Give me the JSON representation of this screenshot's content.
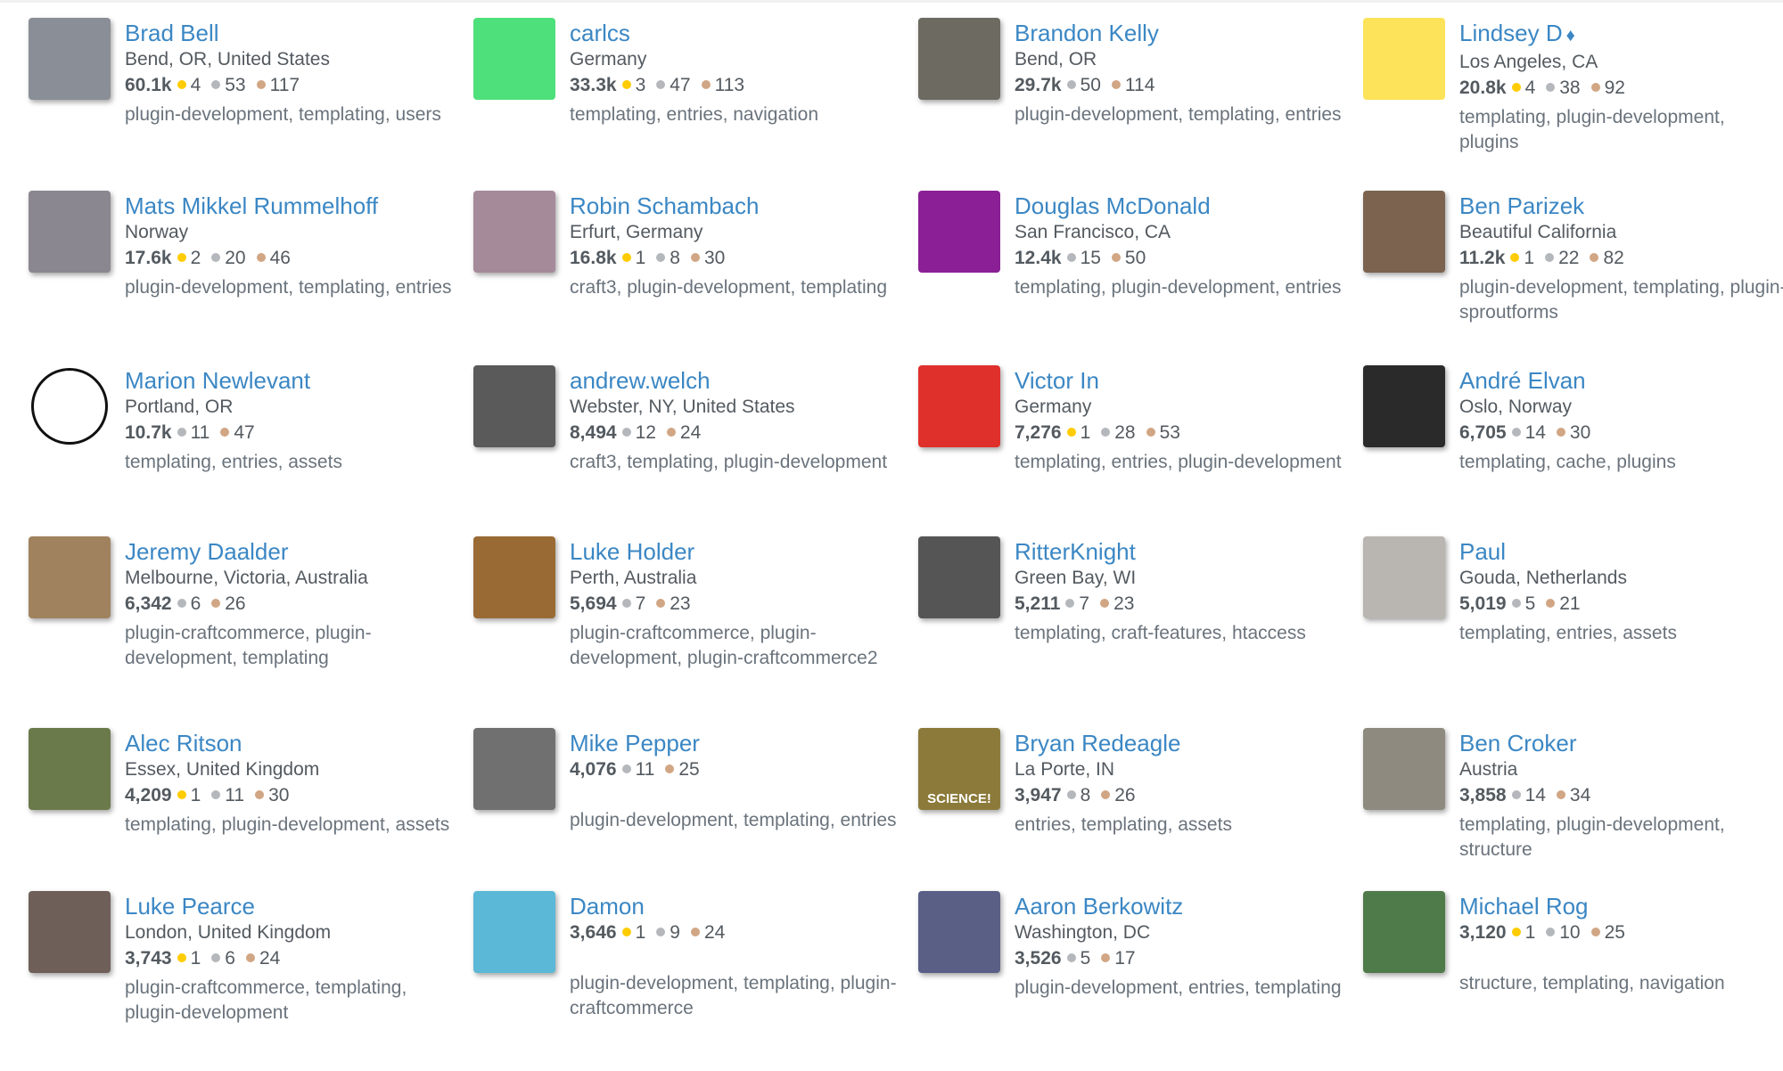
{
  "colors": {
    "link": "#3b87c4",
    "gold": "#ffcc01",
    "silver": "#b4b8bc",
    "bronze": "#d1a684",
    "text": "#535a60",
    "tags": "#6a737c"
  },
  "users": [
    {
      "name": "Brad Bell",
      "location": "Bend, OR, United States",
      "rep": "60.1k",
      "gold": "4",
      "silver": "53",
      "bronze": "117",
      "tags": "plugin-development, templating, users",
      "avatar": "#8a8e96"
    },
    {
      "name": "carlcs",
      "location": "Germany",
      "rep": "33.3k",
      "gold": "3",
      "silver": "47",
      "bronze": "113",
      "tags": "templating, entries, navigation",
      "avatar": "#4ee07a"
    },
    {
      "name": "Brandon Kelly",
      "location": "Bend, OR",
      "rep": "29.7k",
      "gold": null,
      "silver": "50",
      "bronze": "114",
      "tags": "plugin-development, templating, entries",
      "avatar": "#6d6a62"
    },
    {
      "name": "Lindsey D",
      "moderator": "♦",
      "location": "Los Angeles, CA",
      "rep": "20.8k",
      "gold": "4",
      "silver": "38",
      "bronze": "92",
      "tags": "templating, plugin-development, plugins",
      "avatar": "#fde35a"
    },
    {
      "name": "Mats Mikkel Rummelhoff",
      "location": "Norway",
      "rep": "17.6k",
      "gold": "2",
      "silver": "20",
      "bronze": "46",
      "tags": "plugin-development, templating, entries",
      "avatar": "#8b8790"
    },
    {
      "name": "Robin Schambach",
      "location": "Erfurt, Germany",
      "rep": "16.8k",
      "gold": "1",
      "silver": "8",
      "bronze": "30",
      "tags": "craft3, plugin-development, templating",
      "avatar": "#a58a9a"
    },
    {
      "name": "Douglas McDonald",
      "location": "San Francisco, CA",
      "rep": "12.4k",
      "gold": null,
      "silver": "15",
      "bronze": "50",
      "tags": "templating, plugin-development, entries",
      "avatar": "#8a1f96"
    },
    {
      "name": "Ben Parizek",
      "location": "Beautiful California",
      "rep": "11.2k",
      "gold": "1",
      "silver": "22",
      "bronze": "82",
      "tags": "plugin-development, templating, plugin-sproutforms",
      "avatar": "#7b6350"
    },
    {
      "name": "Marion Newlevant",
      "location": "Portland, OR",
      "rep": "10.7k",
      "gold": null,
      "silver": "11",
      "bronze": "47",
      "tags": "templating, entries, assets",
      "avatar": "#ffffff"
    },
    {
      "name": "andrew.welch",
      "location": "Webster, NY, United States",
      "rep": "8,494",
      "gold": null,
      "silver": "12",
      "bronze": "24",
      "tags": "craft3, templating, plugin-development",
      "avatar": "#5a5a5a"
    },
    {
      "name": "Victor In",
      "location": "Germany",
      "rep": "7,276",
      "gold": "1",
      "silver": "28",
      "bronze": "53",
      "tags": "templating, entries, plugin-development",
      "avatar": "#e0302b"
    },
    {
      "name": "André Elvan",
      "location": "Oslo, Norway",
      "rep": "6,705",
      "gold": null,
      "silver": "14",
      "bronze": "30",
      "tags": "templating, cache, plugins",
      "avatar": "#2a2a2a"
    },
    {
      "name": "Jeremy Daalder",
      "location": "Melbourne, Victoria, Australia",
      "rep": "6,342",
      "gold": null,
      "silver": "6",
      "bronze": "26",
      "tags": "plugin-craftcommerce, plugin-development, templating",
      "avatar": "#a0835e"
    },
    {
      "name": "Luke Holder",
      "location": "Perth, Australia",
      "rep": "5,694",
      "gold": null,
      "silver": "7",
      "bronze": "23",
      "tags": "plugin-craftcommerce, plugin-development, plugin-craftcommerce2",
      "avatar": "#9a6a35"
    },
    {
      "name": "RitterKnight",
      "location": "Green Bay, WI",
      "rep": "5,211",
      "gold": null,
      "silver": "7",
      "bronze": "23",
      "tags": "templating, craft-features, htaccess",
      "avatar": "#555555"
    },
    {
      "name": "Paul",
      "location": "Gouda, Netherlands",
      "rep": "5,019",
      "gold": null,
      "silver": "5",
      "bronze": "21",
      "tags": "templating, entries, assets",
      "avatar": "#b9b5b0"
    },
    {
      "name": "Alec Ritson",
      "location": "Essex, United Kingdom",
      "rep": "4,209",
      "gold": "1",
      "silver": "11",
      "bronze": "30",
      "tags": "templating, plugin-development, assets",
      "avatar": "#6a7a4a"
    },
    {
      "name": "Mike Pepper",
      "location": null,
      "rep": "4,076",
      "gold": null,
      "silver": "11",
      "bronze": "25",
      "tags": "plugin-development, templating, entries",
      "avatar": "#707070"
    },
    {
      "name": "Bryan Redeagle",
      "location": "La Porte, IN",
      "rep": "3,947",
      "gold": null,
      "silver": "8",
      "bronze": "26",
      "tags": "entries, templating, assets",
      "avatar": "#8b7a3a",
      "overlay": "SCIENCE!"
    },
    {
      "name": "Ben Croker",
      "location": "Austria",
      "rep": "3,858",
      "gold": null,
      "silver": "14",
      "bronze": "34",
      "tags": "templating, plugin-development, structure",
      "avatar": "#8e8a80"
    },
    {
      "name": "Luke Pearce",
      "location": "London, United Kingdom",
      "rep": "3,743",
      "gold": "1",
      "silver": "6",
      "bronze": "24",
      "tags": "plugin-craftcommerce, templating, plugin-development",
      "avatar": "#6e5f58"
    },
    {
      "name": "Damon",
      "location": null,
      "rep": "3,646",
      "gold": "1",
      "silver": "9",
      "bronze": "24",
      "tags": "plugin-development, templating, plugin-craftcommerce",
      "avatar": "#5bb8d6"
    },
    {
      "name": "Aaron Berkowitz",
      "location": "Washington, DC",
      "rep": "3,526",
      "gold": null,
      "silver": "5",
      "bronze": "17",
      "tags": "plugin-development, entries, templating",
      "avatar": "#5a5f86"
    },
    {
      "name": "Michael Rog",
      "location": null,
      "rep": "3,120",
      "gold": "1",
      "silver": "10",
      "bronze": "25",
      "tags": "structure, templating, navigation",
      "avatar": "#4f7a4a"
    }
  ]
}
